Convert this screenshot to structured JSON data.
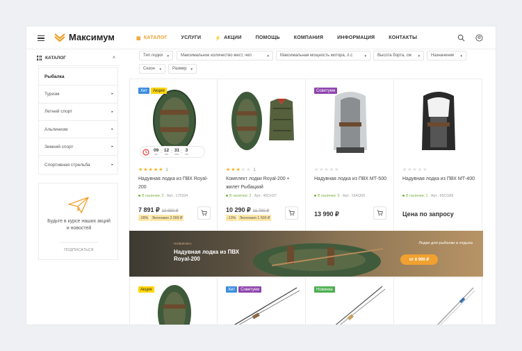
{
  "brand": {
    "name": "Максимум",
    "accent": "#f0a12f"
  },
  "nav": {
    "items": [
      {
        "label": "КАТАЛОГ",
        "icon": "grid-icon",
        "active": true
      },
      {
        "label": "УСЛУГИ"
      },
      {
        "label": "АКЦИИ",
        "icon": "lightning-icon"
      },
      {
        "label": "ПОМОЩЬ"
      },
      {
        "label": "КОМПАНИЯ"
      },
      {
        "label": "ИНФОРМАЦИЯ"
      },
      {
        "label": "КОНТАКТЫ"
      }
    ]
  },
  "sidebar": {
    "title": "КАТАЛОГ",
    "items": [
      {
        "label": "Рыбалка",
        "active": true
      },
      {
        "label": "Туризм"
      },
      {
        "label": "Летний спорт"
      },
      {
        "label": "Альпинизм"
      },
      {
        "label": "Зимний спорт"
      },
      {
        "label": "Спортивная стрельба"
      }
    ],
    "subscribe": {
      "text": "Будьте в курсе наших акций и новостей",
      "link": "ПОДПИСАТЬСЯ"
    }
  },
  "filters": [
    "Тип лодки",
    "Максимальное количество мест, чел",
    "Максимальная мощность мотора, л.с",
    "Высота борта, см",
    "Назначение",
    "Сезон",
    "Размер"
  ],
  "products": [
    {
      "badges": [
        {
          "text": "Хит",
          "color": "#3b8de0"
        },
        {
          "text": "Акция",
          "color": "#ffd500"
        }
      ],
      "rating": 5,
      "reviews": "1",
      "title": "Надувная лодка из ПВХ Royal-200",
      "stock": "В наличии: 3",
      "article": "Арт.: 170334",
      "price": "7 891 ₽",
      "old_price": "10 990 ₽",
      "discount": "-28%",
      "economy": "Экономия 3 099 ₽",
      "timer": {
        "d": "09",
        "h": "12",
        "m": "31",
        "s": "3",
        "d_label": "дн",
        "h_label": "час",
        "m_label": "мин",
        "s_label": "сек"
      }
    },
    {
      "badges": [],
      "rating": 3,
      "reviews": "1",
      "title": "Комплект лодки Royal-200 + жилет Рыбацкий",
      "stock": "В наличии: 2",
      "article": "Арт.: 45CH37",
      "price": "10 290 ₽",
      "old_price": "11 790 ₽",
      "discount": "-13%",
      "economy": "Экономия 1 500 ₽"
    },
    {
      "badges": [
        {
          "text": "Советуем",
          "color": "#8e44ad"
        }
      ],
      "rating": 0,
      "title": "Надувная лодка из ПВХ МТ-500",
      "stock": "В наличии: 5",
      "article": "Арт.: 16AQ09",
      "price": "13 990 ₽"
    },
    {
      "badges": [],
      "rating": 0,
      "title": "Надувная лодка из ПВХ МТ-400",
      "stock": "В наличии: 1",
      "article": "Арт.: 65CG89",
      "price": "Цена по запросу"
    }
  ],
  "banner": {
    "label": "НОВИНКА",
    "title": "Надувная лодка из ПВХ Royal-200",
    "right_text": "Лодки для рыбалки и отдыха",
    "price_button": "от 8 990 ₽"
  },
  "row2": [
    {
      "badges": [
        {
          "text": "Акция",
          "color": "#ffd500"
        }
      ]
    },
    {
      "badges": [
        {
          "text": "Хит",
          "color": "#3b8de0"
        },
        {
          "text": "Советуем",
          "color": "#8e44ad"
        }
      ]
    },
    {
      "badges": [
        {
          "text": "Новинка",
          "color": "#4caf50"
        }
      ]
    },
    {
      "badges": []
    }
  ]
}
